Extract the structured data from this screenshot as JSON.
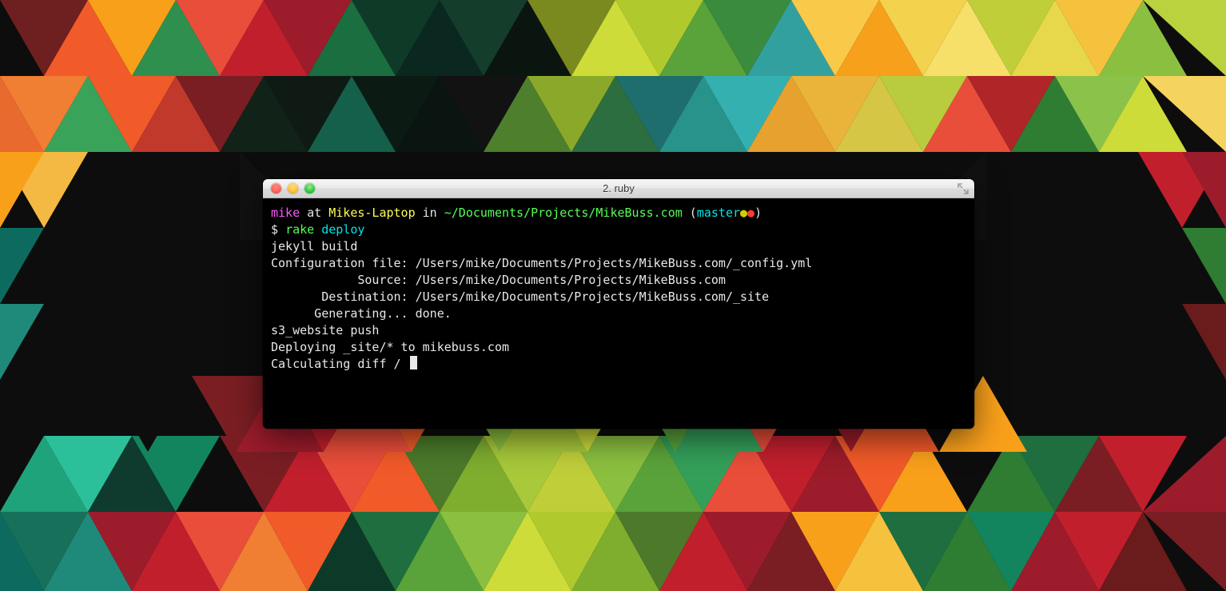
{
  "window": {
    "title": "2. ruby"
  },
  "prompt": {
    "user": "mike",
    "at": " at ",
    "host": "Mikes-Laptop",
    "in": " in ",
    "path": "~/Documents/Projects/MikeBuss.com",
    "open_paren": " (",
    "branch": "master",
    "dot1": "●",
    "dot2": "●",
    "close_paren": ")",
    "symbol": "$ ",
    "cmd1": "rake",
    "space": " ",
    "cmd2": "deploy"
  },
  "out": {
    "l1": "jekyll build",
    "l2": "Configuration file: /Users/mike/Documents/Projects/MikeBuss.com/_config.yml",
    "l3": "            Source: /Users/mike/Documents/Projects/MikeBuss.com",
    "l4": "       Destination: /Users/mike/Documents/Projects/MikeBuss.com/_site",
    "l5": "      Generating... done.",
    "l6": "s3_website push",
    "l7": "Deploying _site/* to mikebuss.com",
    "l8": "Calculating diff / "
  }
}
